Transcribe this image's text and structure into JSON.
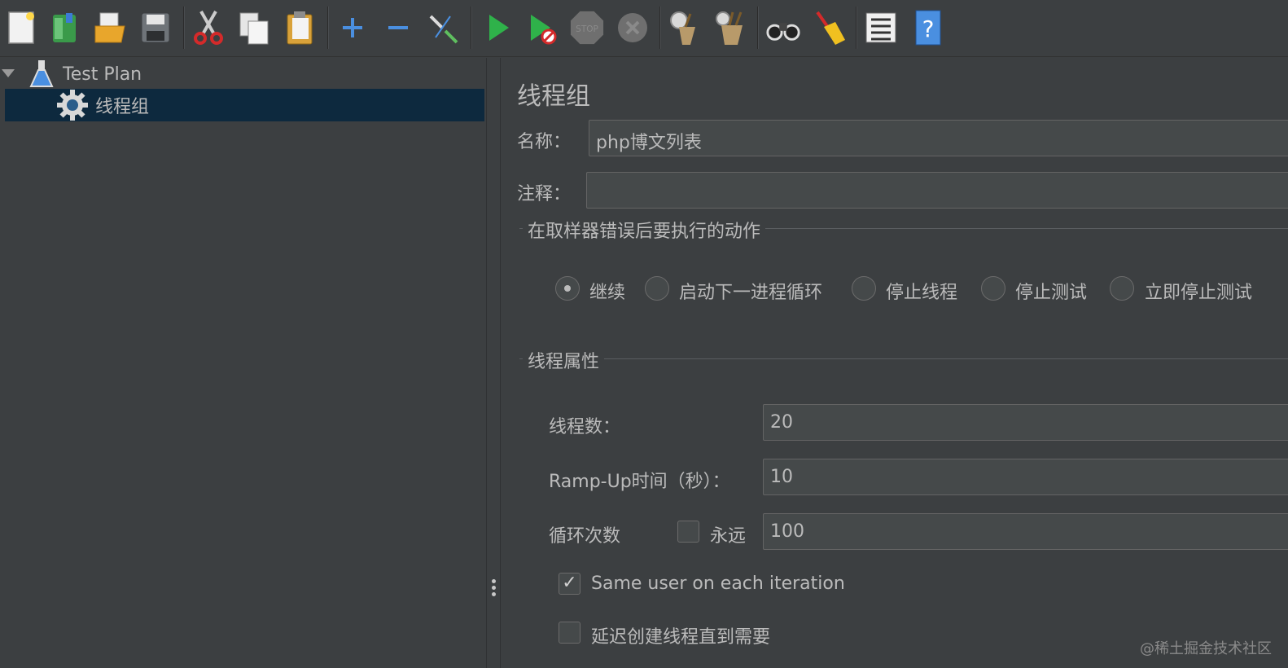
{
  "toolbar": {
    "buttons": [
      "new-icon",
      "templates-icon",
      "open-icon",
      "save-icon",
      "cut-icon",
      "copy-icon",
      "paste-icon",
      "expand-icon",
      "collapse-icon",
      "toggle-icon",
      "start-icon",
      "start-no-pauses-icon",
      "stop-icon",
      "shutdown-icon",
      "clear-icon",
      "clear-all-icon",
      "search-icon",
      "reset-search-icon",
      "function-helper-icon",
      "help-icon"
    ]
  },
  "tree": {
    "root_label": "Test Plan",
    "child_label": "线程组"
  },
  "editor": {
    "title": "线程组",
    "name_label": "名称：",
    "name_value": "php博文列表",
    "comment_label": "注释：",
    "comment_value": "",
    "error_group_title": "在取样器错误后要执行的动作",
    "error_actions": [
      {
        "label": "继续",
        "selected": true
      },
      {
        "label": "启动下一进程循环",
        "selected": false
      },
      {
        "label": "停止线程",
        "selected": false
      },
      {
        "label": "停止测试",
        "selected": false
      },
      {
        "label": "立即停止测试",
        "selected": false
      }
    ],
    "thread_group_title": "线程属性",
    "threads_label": "线程数：",
    "threads_value": "20",
    "rampup_label": "Ramp-Up时间（秒）：",
    "rampup_value": "10",
    "loop_label": "循环次数",
    "forever_label": "永远",
    "forever_checked": false,
    "loop_value": "100",
    "same_user_label": "Same user on each iteration",
    "same_user_checked": true,
    "delay_label": "延迟创建线程直到需要",
    "delay_checked": false
  },
  "watermark": "@稀土掘金技术社区"
}
